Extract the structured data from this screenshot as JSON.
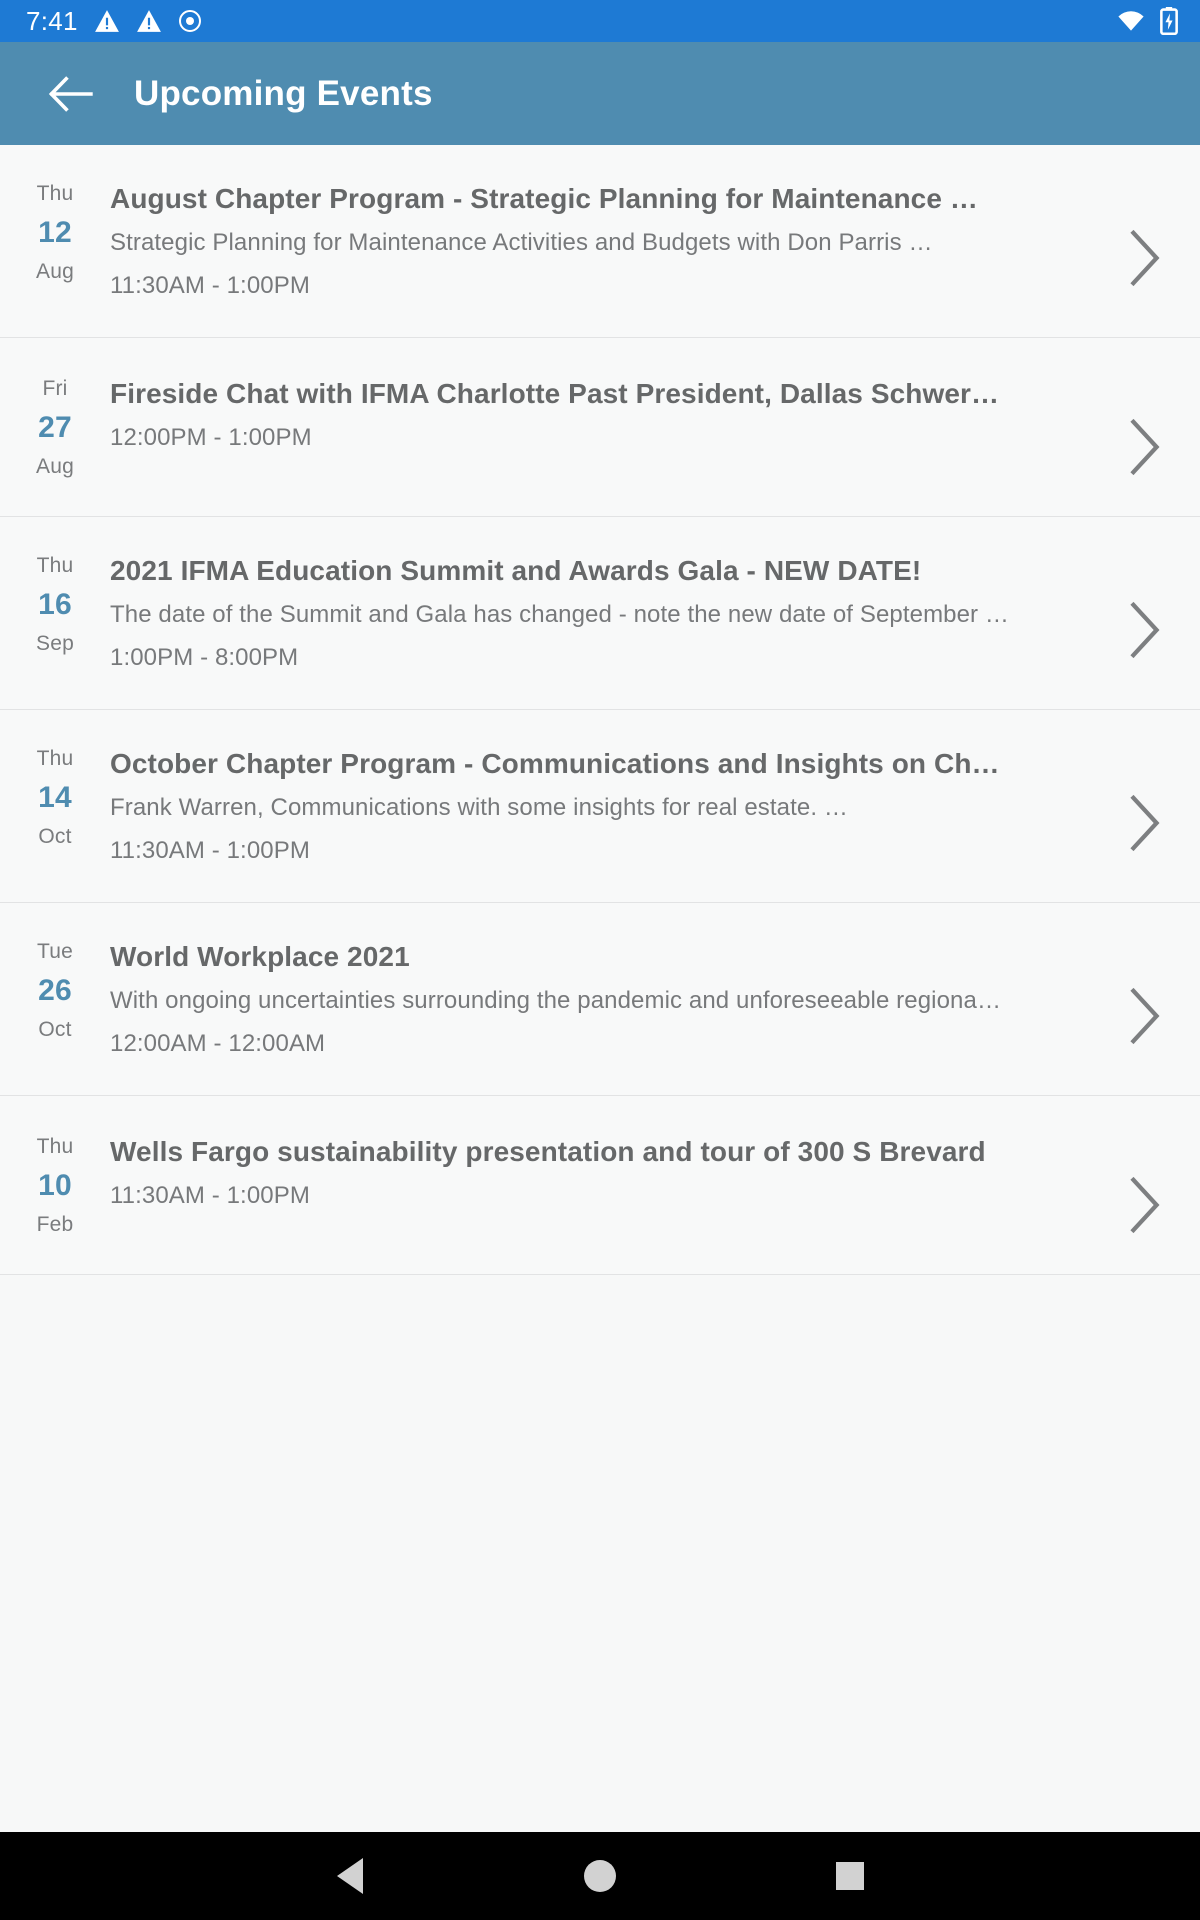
{
  "status_bar": {
    "time": "7:41",
    "icons": [
      "warning-triangle-icon",
      "warning-triangle-icon",
      "record-circle-icon",
      "wifi-icon",
      "battery-charging-icon"
    ],
    "background_color": "#1e7ad4"
  },
  "app_bar": {
    "title": "Upcoming Events",
    "back_icon": "arrow-back-icon",
    "background_color": "#4f8cb0"
  },
  "theme": {
    "accent_color": "#4f8cb0",
    "title_color": "#666869",
    "body_color": "#77797b",
    "list_background": "#f8f9f9",
    "divider_color": "#e2e3e4"
  },
  "events": [
    {
      "weekday": "Thu",
      "day": "12",
      "month": "Aug",
      "title": "August Chapter Program - Strategic Planning for Maintenance …",
      "subtitle": "Strategic Planning for Maintenance Activities and Budgets with Don Parris  …",
      "time": "11:30AM - 1:00PM",
      "chevron": "chevron-right-icon"
    },
    {
      "weekday": "Fri",
      "day": "27",
      "month": "Aug",
      "title": "Fireside Chat with IFMA Charlotte Past President, Dallas Schwer…",
      "subtitle": "",
      "time": "12:00PM - 1:00PM",
      "chevron": "chevron-right-icon"
    },
    {
      "weekday": "Thu",
      "day": "16",
      "month": "Sep",
      "title": "2021 IFMA Education Summit and Awards Gala - NEW DATE!",
      "subtitle": "The date of the Summit and Gala has changed - note the new date of September …",
      "time": "1:00PM - 8:00PM",
      "chevron": "chevron-right-icon"
    },
    {
      "weekday": "Thu",
      "day": "14",
      "month": "Oct",
      "title": "October Chapter Program - Communications and Insights on Ch…",
      "subtitle": "Frank Warren,  Communications with some insights for real estate.  …",
      "time": "11:30AM - 1:00PM",
      "chevron": "chevron-right-icon"
    },
    {
      "weekday": "Tue",
      "day": "26",
      "month": "Oct",
      "title": "World Workplace 2021",
      "subtitle": "With ongoing uncertainties surrounding the pandemic and unforeseeable regiona…",
      "time": "12:00AM - 12:00AM",
      "chevron": "chevron-right-icon"
    },
    {
      "weekday": "Thu",
      "day": "10",
      "month": "Feb",
      "title": "Wells Fargo sustainability presentation and tour of 300 S Brevard",
      "subtitle": "",
      "time": "11:30AM - 1:00PM",
      "chevron": "chevron-right-icon"
    }
  ],
  "nav_bar": {
    "back_label": "back-triangle-icon",
    "home_label": "home-circle-icon",
    "recents_label": "recents-square-icon"
  }
}
